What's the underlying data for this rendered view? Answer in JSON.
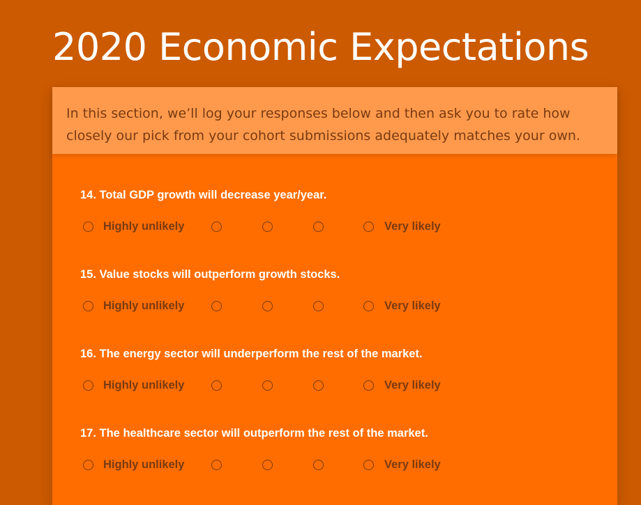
{
  "survey": {
    "title": "2020 Economic Expectations",
    "intro": "In this section, we’ll log your responses below and then ask you to rate how closely our pick from your cohort submissions adequately matches your own.",
    "scale": {
      "min_label": "Highly unlikely",
      "max_label": "Very likely"
    },
    "questions": [
      {
        "text": "14. Total GDP growth will decrease year/year."
      },
      {
        "text": "15. Value stocks will outperform growth stocks."
      },
      {
        "text": "16. The energy sector will underperform the rest of the market."
      },
      {
        "text": "17. The healthcare sector will outperform the rest of the market."
      }
    ]
  }
}
